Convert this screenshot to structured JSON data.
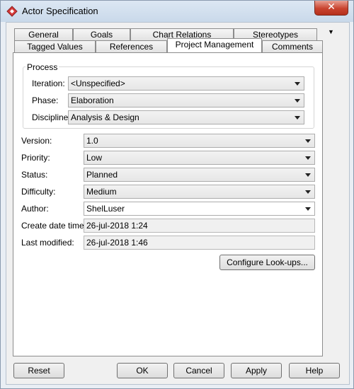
{
  "window": {
    "title": "Actor Specification",
    "close_glyph": "✕"
  },
  "tabs": {
    "row1": [
      "General",
      "Goals",
      "Chart Relations",
      "Stereotypes"
    ],
    "row2": [
      "Tagged Values",
      "References",
      "Project Management",
      "Comments"
    ],
    "overflow_glyph": "▼"
  },
  "process": {
    "title": "Process",
    "iteration": {
      "label": "Iteration:",
      "value": "<Unspecified>"
    },
    "phase": {
      "label": "Phase:",
      "value": "Elaboration"
    },
    "discipline": {
      "label": "Discipline:",
      "value": "Analysis & Design"
    }
  },
  "fields": {
    "version": {
      "label": "Version:",
      "value": "1.0"
    },
    "priority": {
      "label": "Priority:",
      "value": "Low"
    },
    "status": {
      "label": "Status:",
      "value": "Planned"
    },
    "difficulty": {
      "label": "Difficulty:",
      "value": "Medium"
    },
    "author": {
      "label": "Author:",
      "value": "ShelLuser"
    },
    "create_date": {
      "label": "Create date time:",
      "value": "26-jul-2018 1:24"
    },
    "last_modified": {
      "label": "Last modified:",
      "value": "26-jul-2018 1:46"
    }
  },
  "buttons": {
    "configure": "Configure Look-ups...",
    "reset": "Reset",
    "ok": "OK",
    "cancel": "Cancel",
    "apply": "Apply",
    "help": "Help"
  },
  "colors": {
    "accent_icon": "#d63b3b",
    "close": "#c9432f"
  },
  "icons": {
    "app": "actor-diamond-icon",
    "close": "close-icon",
    "dropdown": "chevron-down-icon"
  }
}
